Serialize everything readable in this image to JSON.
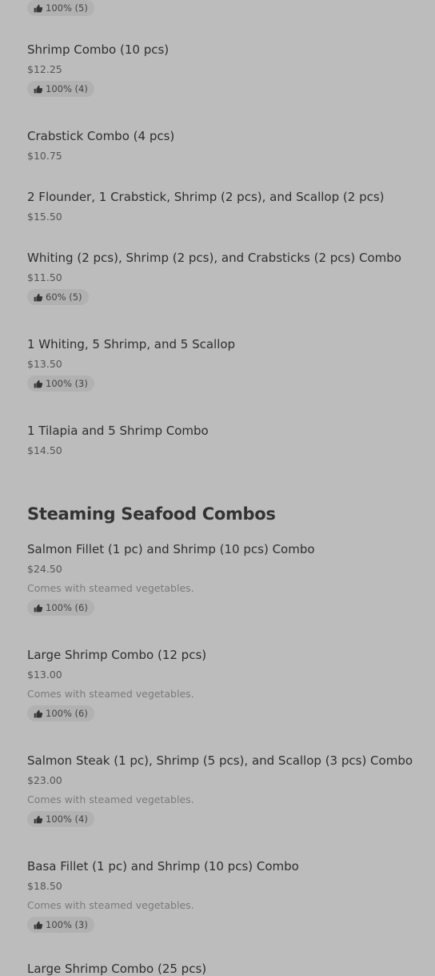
{
  "top_badge": "100% (5)",
  "items_group1": [
    {
      "name": "Shrimp Combo (10 pcs)",
      "price": "$12.25",
      "rating": "100% (4)"
    },
    {
      "name": "Crabstick Combo (4 pcs)",
      "price": "$10.75"
    },
    {
      "name": "2 Flounder, 1 Crabstick, Shrimp (2 pcs), and Scallop (2 pcs)",
      "price": "$15.50"
    },
    {
      "name": "Whiting (2 pcs), Shrimp (2 pcs), and Crabsticks (2 pcs) Combo",
      "price": "$11.50",
      "rating": "60% (5)"
    },
    {
      "name": "1 Whiting, 5 Shrimp, and 5 Scallop",
      "price": "$13.50",
      "rating": "100% (3)"
    },
    {
      "name": "1 Tilapia and 5 Shrimp Combo",
      "price": "$14.50"
    }
  ],
  "section2": {
    "title": "Steaming Seafood Combos",
    "items": [
      {
        "name": "Salmon Fillet (1 pc) and Shrimp (10 pcs) Combo",
        "price": "$24.50",
        "desc": "Comes with steamed vegetables.",
        "rating": "100% (6)"
      },
      {
        "name": "Large Shrimp Combo (12 pcs)",
        "price": "$13.00",
        "desc": "Comes with steamed vegetables.",
        "rating": "100% (6)"
      },
      {
        "name": "Salmon Steak (1 pc), Shrimp (5 pcs), and Scallop (3 pcs) Combo",
        "price": "$23.00",
        "desc": "Comes with steamed vegetables.",
        "rating": "100% (4)"
      },
      {
        "name": "Basa Fillet (1 pc) and Shrimp (10 pcs) Combo",
        "price": "$18.50",
        "desc": "Comes with steamed vegetables.",
        "rating": "100% (3)"
      },
      {
        "name": "Large Shrimp Combo (25 pcs)"
      }
    ]
  },
  "icons": {
    "rating": "thumbs-up-icon"
  }
}
